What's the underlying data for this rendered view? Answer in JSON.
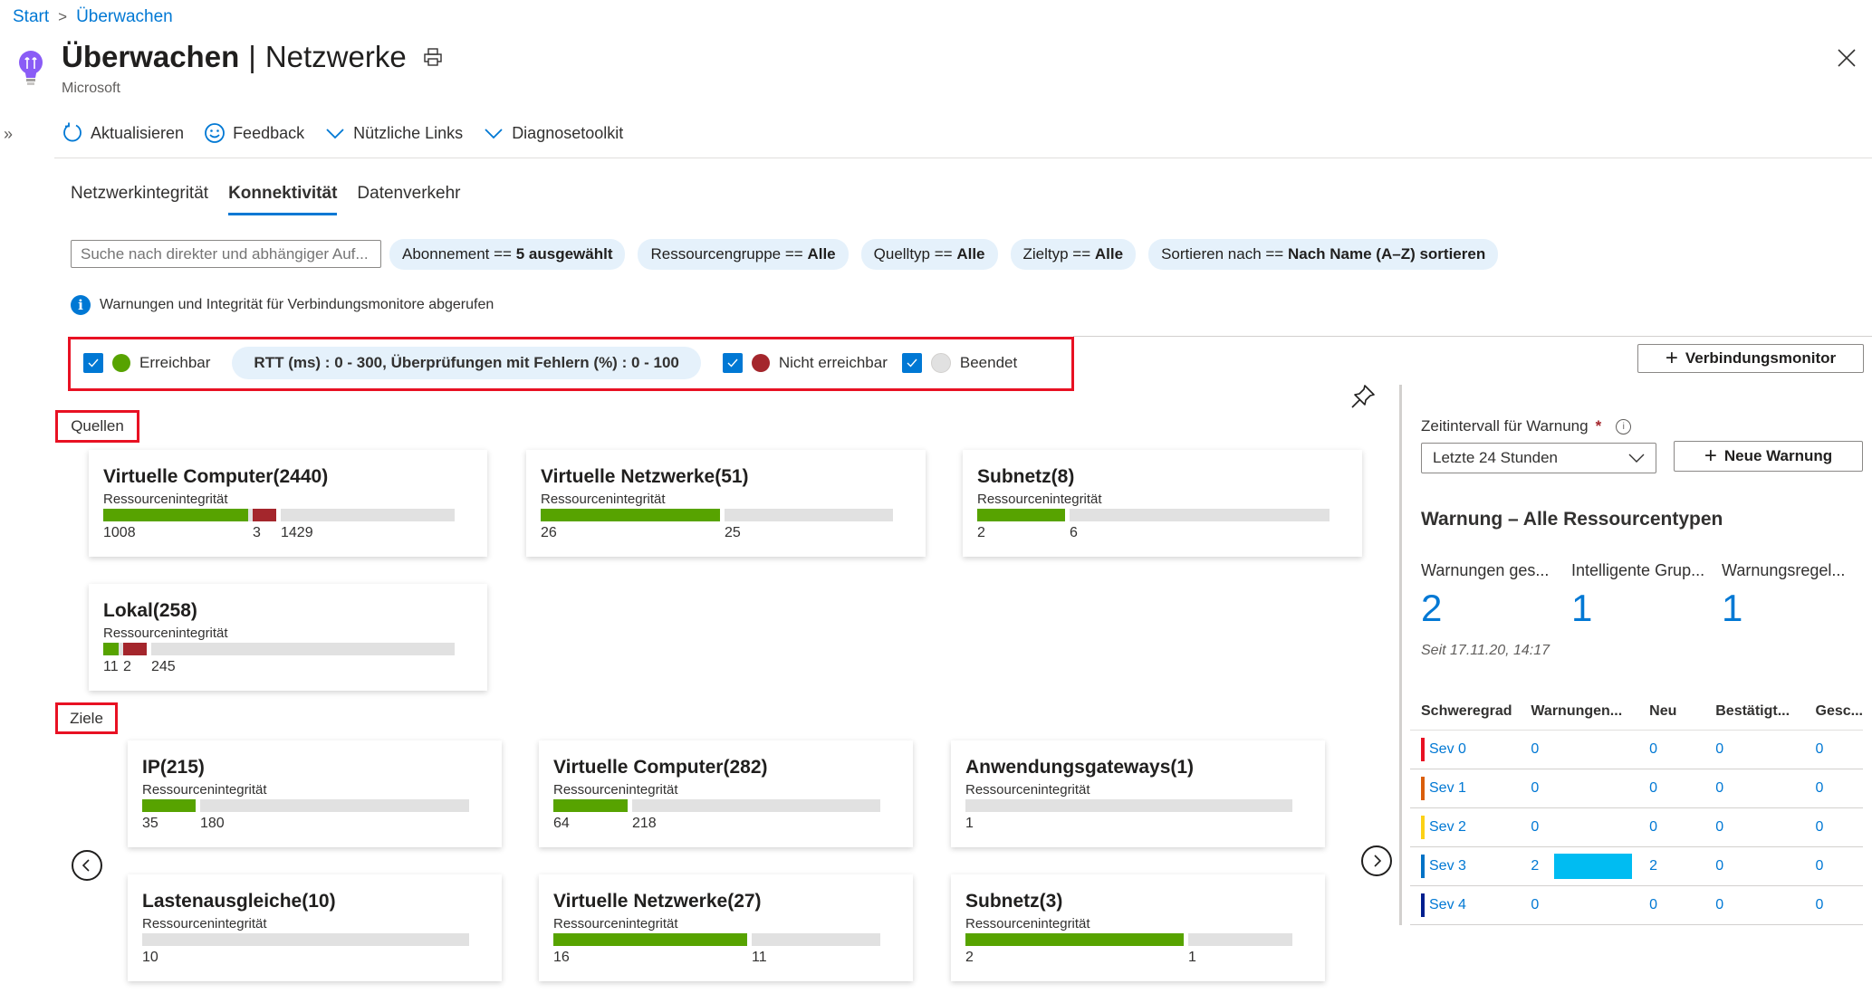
{
  "breadcrumb": [
    {
      "label": "Start"
    },
    {
      "label": "Überwachen"
    }
  ],
  "breadcrumb_sep": ">",
  "header": {
    "title_main": "Überwachen",
    "title_sep": "|",
    "title_sub": "Netzwerke",
    "publisher": "Microsoft",
    "icon": "lightbulb-icon"
  },
  "toolbar": {
    "expand_glyph": "»",
    "items": [
      {
        "label": "Aktualisieren",
        "icon": "refresh-icon"
      },
      {
        "label": "Feedback",
        "icon": "smiley-icon"
      },
      {
        "label": "Nützliche Links",
        "icon": "chevron-down-icon"
      },
      {
        "label": "Diagnosetoolkit",
        "icon": "chevron-down-icon"
      }
    ]
  },
  "tabs": [
    {
      "label": "Netzwerkintegrität",
      "active": false
    },
    {
      "label": "Konnektivität",
      "active": true
    },
    {
      "label": "Datenverkehr",
      "active": false
    }
  ],
  "search": {
    "placeholder": "Suche nach direkter und abhängiger Auf...",
    "value": ""
  },
  "filters": [
    {
      "key": "Abonnement ==",
      "value": "5 ausgewählt"
    },
    {
      "key": "Ressourcengruppe ==",
      "value": "Alle"
    },
    {
      "key": "Quelltyp ==",
      "value": "Alle"
    },
    {
      "key": "Zieltyp ==",
      "value": "Alle"
    },
    {
      "key": "Sortieren nach ==",
      "value": "Nach Name (A–Z) sortieren"
    }
  ],
  "info_message": "Warnungen und Integrität für Verbindungsmonitore abgerufen",
  "legend": {
    "reachable": {
      "label": "Erreichbar",
      "checked": true,
      "color": "#57a300"
    },
    "rtt_filter": "RTT (ms) : 0 - 300, Überprüfungen mit Fehlern (%) : 0 - 100",
    "unreachable": {
      "label": "Nicht erreichbar",
      "checked": true,
      "color": "#a4262c"
    },
    "stopped": {
      "label": "Beendet",
      "checked": true,
      "color": "#e1e1e1"
    }
  },
  "add_monitor_button": "Verbindungsmonitor",
  "sources_label": "Quellen",
  "targets_label": "Ziele",
  "card_subtitle": "Ressourcenintegrität",
  "sources": [
    {
      "title": "Virtuelle Computer(2440)",
      "reachable": 1008,
      "unreachable": 3,
      "stopped": 1429
    },
    {
      "title": "Virtuelle Netzwerke(51)",
      "reachable": 26,
      "unreachable": 0,
      "stopped": 25
    },
    {
      "title": "Subnetz(8)",
      "reachable": 2,
      "unreachable": 0,
      "stopped": 6
    },
    {
      "title": "Lokal(258)",
      "reachable": 11,
      "unreachable": 2,
      "stopped": 245
    }
  ],
  "targets": [
    {
      "title": "IP(215)",
      "reachable": 35,
      "unreachable": 0,
      "stopped": 180
    },
    {
      "title": "Virtuelle Computer(282)",
      "reachable": 64,
      "unreachable": 0,
      "stopped": 218
    },
    {
      "title": "Anwendungsgateways(1)",
      "reachable": 0,
      "unreachable": 0,
      "stopped": 1
    },
    {
      "title": "Lastenausgleiche(10)",
      "reachable": 0,
      "unreachable": 0,
      "stopped": 10
    },
    {
      "title": "Virtuelle Netzwerke(27)",
      "reachable": 16,
      "unreachable": 0,
      "stopped": 11
    },
    {
      "title": "Subnetz(3)",
      "reachable": 2,
      "unreachable": 0,
      "stopped": 1
    }
  ],
  "alerts_panel": {
    "time_label": "Zeitintervall für Warnung",
    "required_mark": "*",
    "time_value": "Letzte 24 Stunden",
    "new_alert_button": "Neue Warnung",
    "heading": "Warnung – Alle Ressourcentypen",
    "stats": [
      {
        "label": "Warnungen ges...",
        "value": "2"
      },
      {
        "label": "Intelligente Grup...",
        "value": "1"
      },
      {
        "label": "Warnungsregel...",
        "value": "1"
      }
    ],
    "since": "Seit 17.11.20, 14:17",
    "table": {
      "headers": [
        "Schweregrad",
        "Warnungen...",
        "Neu",
        "Bestätigt...",
        "Gesc..."
      ],
      "rows": [
        {
          "sev": "Sev 0",
          "color": "#e81123",
          "total": "0",
          "new": "0",
          "ack": "0",
          "closed": "0",
          "fraction": 0
        },
        {
          "sev": "Sev 1",
          "color": "#da5e0b",
          "total": "0",
          "new": "0",
          "ack": "0",
          "closed": "0",
          "fraction": 0
        },
        {
          "sev": "Sev 2",
          "color": "#fcd116",
          "total": "0",
          "new": "0",
          "ack": "0",
          "closed": "0",
          "fraction": 0
        },
        {
          "sev": "Sev 3",
          "color": "#0072c6",
          "total": "2",
          "new": "2",
          "ack": "0",
          "closed": "0",
          "fraction": 1
        },
        {
          "sev": "Sev 4",
          "color": "#001f8f",
          "total": "0",
          "new": "0",
          "ack": "0",
          "closed": "0",
          "fraction": 0
        }
      ]
    }
  }
}
